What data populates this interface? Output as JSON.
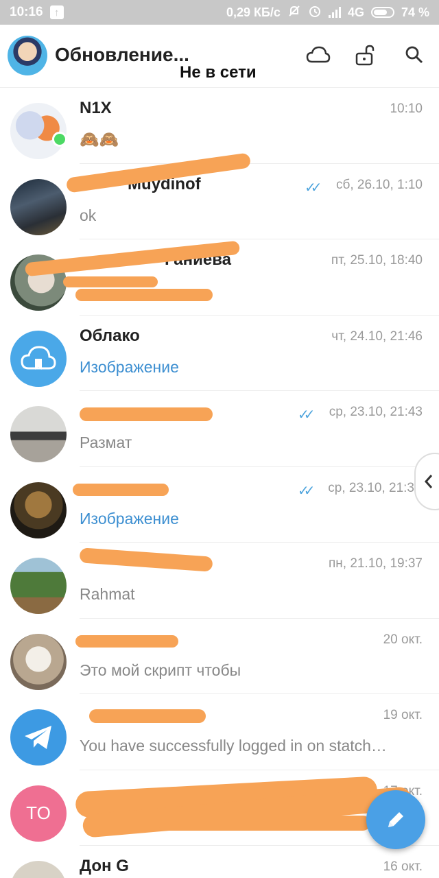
{
  "status_bar": {
    "time": "10:16",
    "net_speed": "0,29 КБ/с",
    "network": "4G",
    "battery": "74 %"
  },
  "header": {
    "title": "Обновление...",
    "connection_status": "Не в сети",
    "icons": [
      "cloud-icon",
      "unlock-icon",
      "search-icon"
    ]
  },
  "chats": [
    {
      "name": "N1X",
      "message": "🙈🙈",
      "time": "10:10",
      "online": true,
      "avatar": "anime-avatar"
    },
    {
      "name": "Muydinof",
      "message": "ok",
      "time": "сб, 26.10, 1:10",
      "read": true,
      "avatar": "city-photo"
    },
    {
      "name": "Ганиева",
      "message": "",
      "time": "пт, 25.10, 18:40",
      "avatar": "person-photo"
    },
    {
      "name": "Облако",
      "message": "Изображение",
      "time": "чт, 24.10, 21:46",
      "media": true,
      "avatar": "cloud-avatar"
    },
    {
      "name": "",
      "message": "Размат",
      "time": "ср, 23.10, 21:43",
      "read": true,
      "avatar": "office-photo"
    },
    {
      "name": "",
      "message": "Изображение",
      "time": "ср, 23.10, 21:3",
      "read": true,
      "media": true,
      "avatar": "lion-photo"
    },
    {
      "name": "",
      "message": "Rahmat",
      "time": "пн, 21.10, 19:37",
      "avatar": "nature-photo"
    },
    {
      "name": "",
      "message": "Это мой скрипт чтобы",
      "time": "20 окт.",
      "avatar": "hoodie-photo"
    },
    {
      "name": "",
      "message": "You have successfully logged in on statch…",
      "time": "19 окт.",
      "avatar": "telegram-logo"
    },
    {
      "name": "",
      "message": "",
      "time": "17 окт.",
      "avatar_initials": "TO"
    },
    {
      "name": "Дон G",
      "message": "",
      "time": "16 окт.",
      "avatar": "building-photo"
    }
  ],
  "colors": {
    "accent": "#4aa0e6",
    "media_text": "#3d8fd1",
    "check_marks": "#4ea4dd",
    "redaction": "#f7a356",
    "online": "#4cd964",
    "initials_avatar": "#ef6f92"
  }
}
